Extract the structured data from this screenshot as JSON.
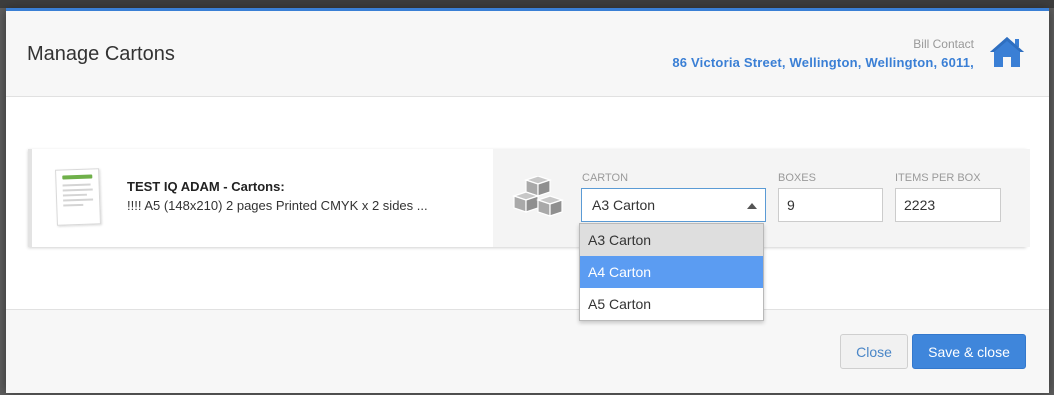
{
  "modal": {
    "title": "Manage Cartons",
    "bill_contact_label": "Bill Contact",
    "bill_contact_address": "86 Victoria Street, Wellington, Wellington, 6011,"
  },
  "product": {
    "title": "TEST IQ ADAM - Cartons:",
    "description": "!!!! A5 (148x210) 2 pages Printed CMYK x 2 sides ..."
  },
  "carton_field": {
    "label": "CARTON",
    "selected": "A3 Carton",
    "options": [
      "A3 Carton",
      "A4 Carton",
      "A5 Carton"
    ]
  },
  "boxes_field": {
    "label": "BOXES",
    "value": "9"
  },
  "items_field": {
    "label": "ITEMS PER BOX",
    "value": "2223"
  },
  "footer": {
    "close_label": "Close",
    "save_label": "Save & close"
  },
  "colors": {
    "accent": "#3a7fd5",
    "dropdown_hover": "#5b9cf2",
    "save_button": "#3f86db"
  },
  "icons": [
    "home-icon",
    "boxes-icon",
    "dropdown-arrow-icon",
    "product-thumbnail"
  ]
}
